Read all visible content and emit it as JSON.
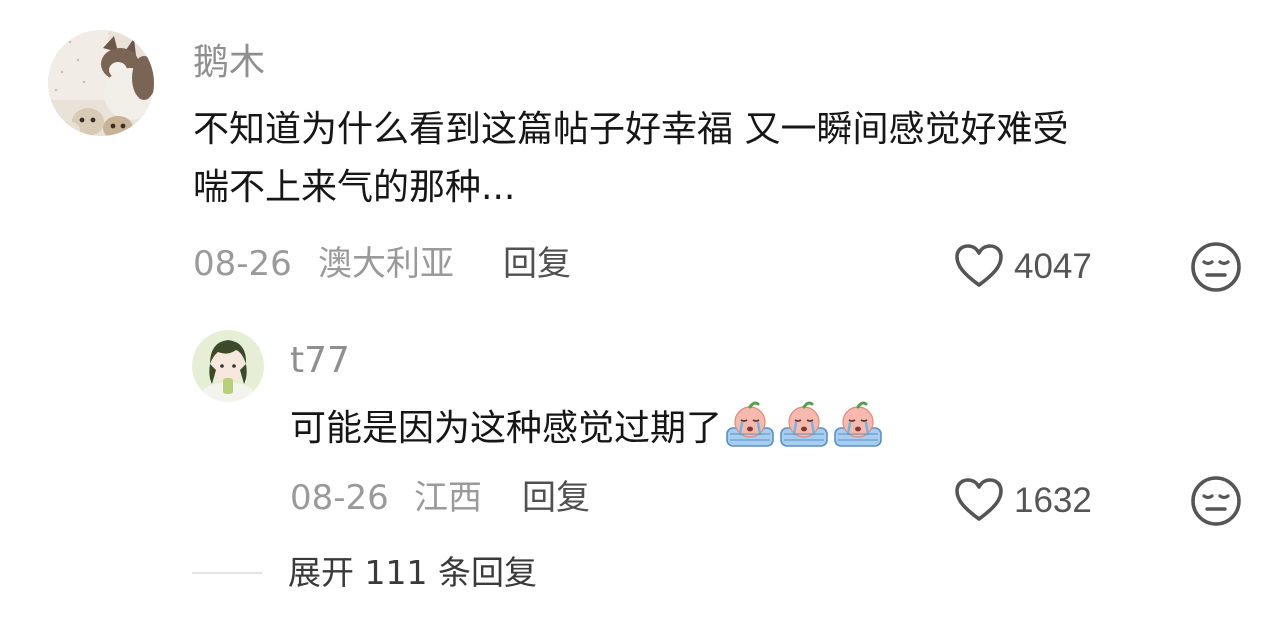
{
  "comment": {
    "username": "鹅木",
    "text_line1": "不知道为什么看到这篇帖子好幸福 又一瞬间感觉好难受",
    "text_line2": "喘不上来气的那种...",
    "date": "08-26",
    "location": "澳大利亚",
    "reply_label": "回复",
    "like_count": "4047"
  },
  "reply": {
    "username": "t77",
    "text": "可能是因为这种感觉过期了",
    "emoji": "crying-face-emoji",
    "emoji_count": 3,
    "date": "08-26",
    "location": "江西",
    "reply_label": "回复",
    "like_count": "1632"
  },
  "expand": {
    "label": "展开 111 条回复"
  },
  "icons": {
    "like": "heart-outline-icon",
    "reaction": "face-emoji-icon"
  },
  "colors": {
    "username": "#8f8f8f",
    "meta": "#9a9a9a",
    "text": "#161616"
  }
}
